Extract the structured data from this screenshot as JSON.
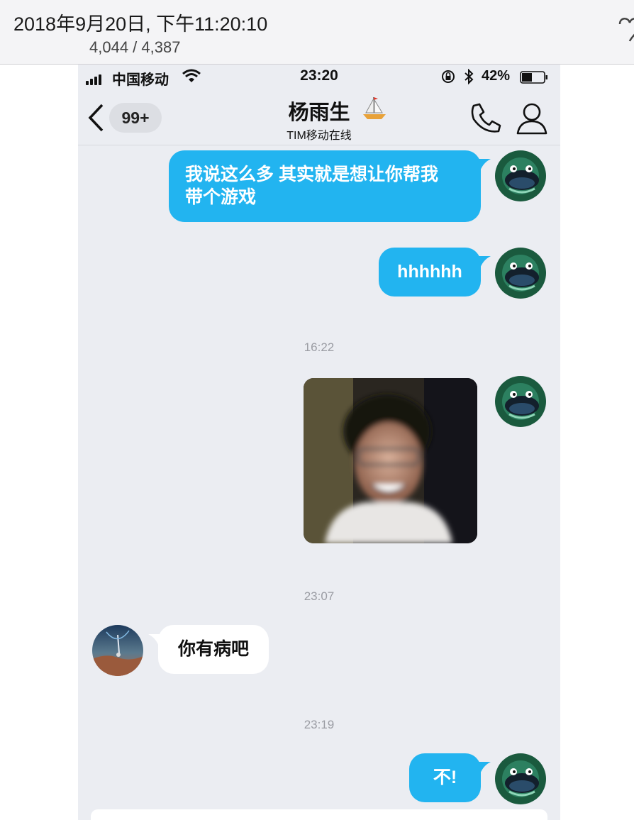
{
  "viewer": {
    "datetime": "2018年9月20日, 下午11:20:10",
    "counter": "4,044 / 4,387"
  },
  "status_bar": {
    "carrier": "中国移动",
    "time": "23:20",
    "battery": "42%"
  },
  "nav": {
    "unread_badge": "99+",
    "contact_name": "杨雨生",
    "contact_status": "TIM移动在线"
  },
  "messages": [
    {
      "from": "me",
      "text": "我说这么多 其实就是想让你帮我\n带个游戏"
    },
    {
      "from": "me",
      "text": "hhhhhh"
    },
    {
      "type": "timestamp",
      "text": "16:22"
    },
    {
      "from": "me",
      "type": "image"
    },
    {
      "type": "timestamp",
      "text": "23:07"
    },
    {
      "from": "them",
      "text": "你有病吧"
    },
    {
      "type": "timestamp",
      "text": "23:19"
    },
    {
      "from": "me",
      "text": "不!"
    }
  ],
  "colors": {
    "outgoing_bubble": "#22b4f0",
    "incoming_bubble": "#ffffff",
    "chat_background": "#ebedf2"
  }
}
